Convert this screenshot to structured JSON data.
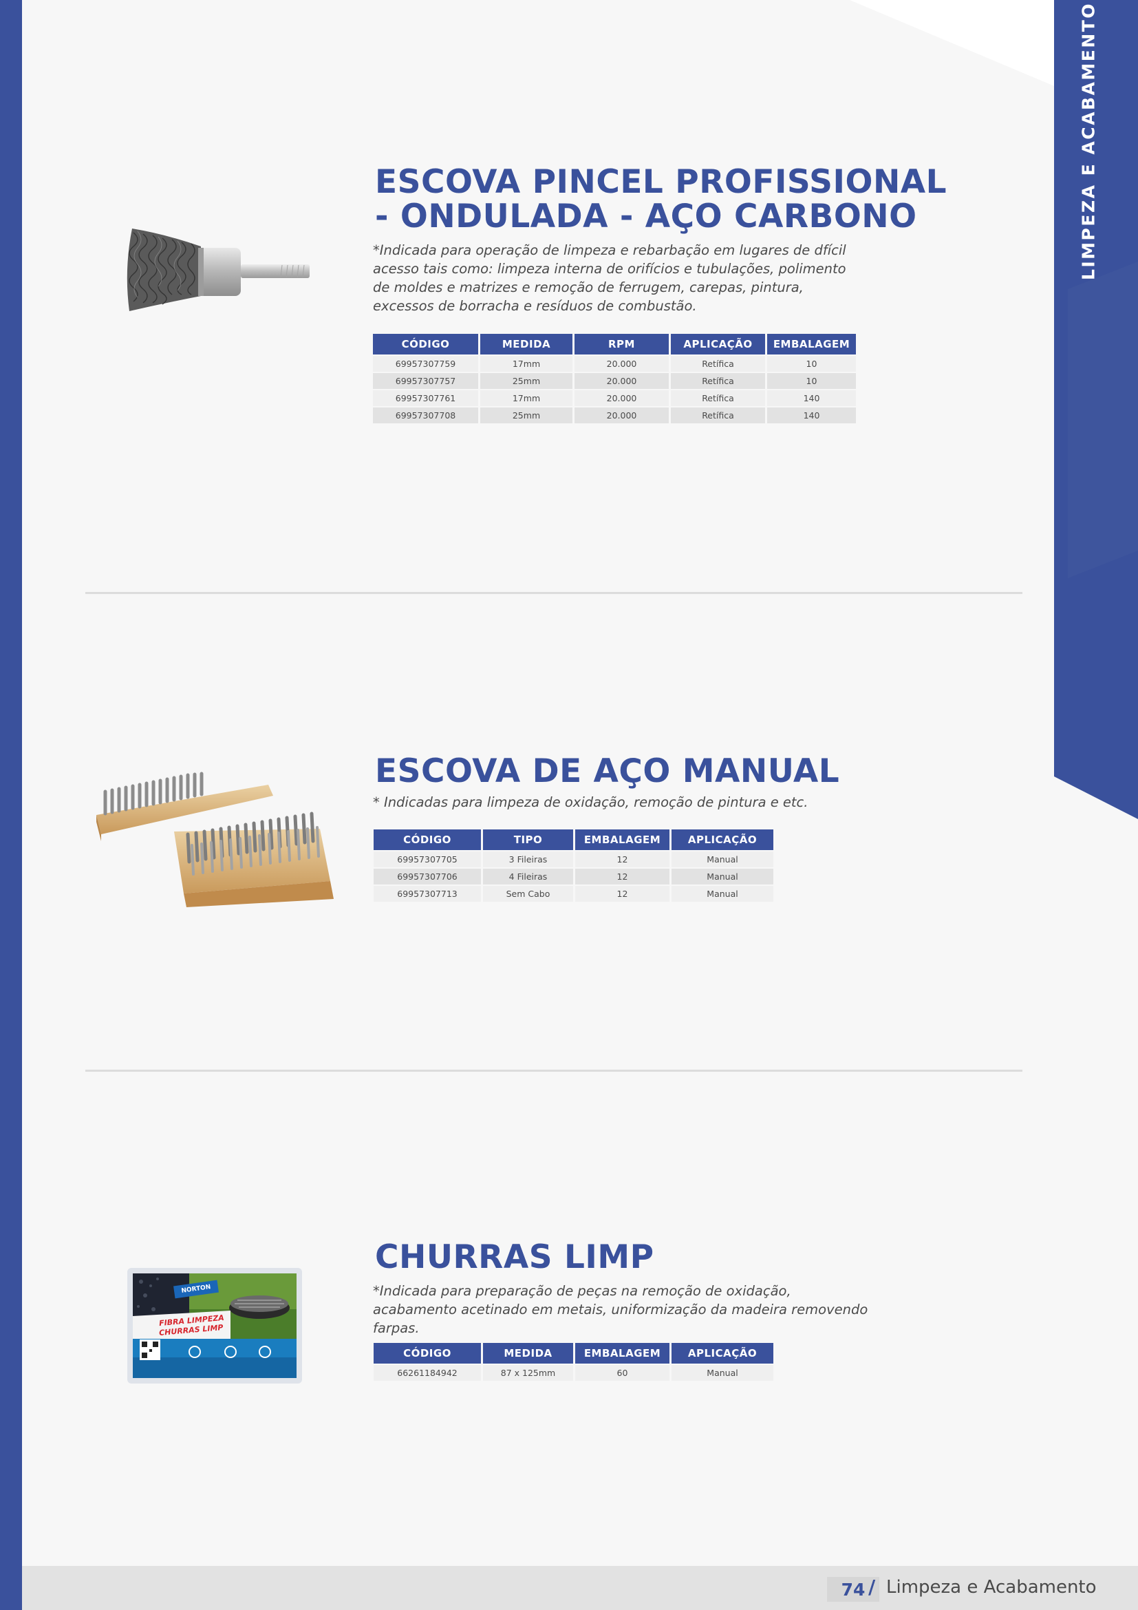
{
  "sidebar": {
    "label": "LIMPEZA E ACABAMENTO"
  },
  "colors": {
    "brand": "#3a519c",
    "background": "#f7f7f7",
    "row_light": "#efefef",
    "row_dark": "#e2e2e2"
  },
  "products": [
    {
      "title_line1": "ESCOVA PINCEL PROFISSIONAL",
      "title_line2": "- ONDULADA - AÇO CARBONO",
      "description": "*Indicada para operação de limpeza e rebarbação em lugares de dfícil acesso tais como: limpeza interna de orifícios e tubulações, polimento de moldes e matrizes e remoção de ferrugem, carepas, pintura, excessos de borracha e resíduos de combustão.",
      "image_icon": "wire-end-brush-icon",
      "columns": [
        "CÓDIGO",
        "MEDIDA",
        "RPM",
        "APLICAÇÃO",
        "EMBALAGEM"
      ],
      "rows": [
        [
          "69957307759",
          "17mm",
          "20.000",
          "Retífica",
          "10"
        ],
        [
          "69957307757",
          "25mm",
          "20.000",
          "Retífica",
          "10"
        ],
        [
          "69957307761",
          "17mm",
          "20.000",
          "Retífica",
          "140"
        ],
        [
          "69957307708",
          "25mm",
          "20.000",
          "Retífica",
          "140"
        ]
      ]
    },
    {
      "title_line1": "ESCOVA DE AÇO MANUAL",
      "description": "* Indicadas para limpeza de oxidação, remoção de pintura e etc.",
      "image_icon": "hand-wire-brush-icon",
      "columns": [
        "CÓDIGO",
        "TIPO",
        "EMBALAGEM",
        "APLICAÇÃO"
      ],
      "rows": [
        [
          "69957307705",
          "3 Fileiras",
          "12",
          "Manual"
        ],
        [
          "69957307706",
          "4 Fileiras",
          "12",
          "Manual"
        ],
        [
          "69957307713",
          "Sem Cabo",
          "12",
          "Manual"
        ]
      ]
    },
    {
      "title_line1": "CHURRAS LIMP",
      "description": "*Indicada para preparação de peças na remoção de oxidação, acabamento acetinado em metais, uniformização da madeira removendo farpas.",
      "image_icon": "cleaning-pad-package-icon",
      "package": {
        "brand": "NORTON",
        "line1": "FIBRA LIMPEZA",
        "line2": "CHURRAS LIMP"
      },
      "columns": [
        "CÓDIGO",
        "MEDIDA",
        "EMBALAGEM",
        "APLICAÇÃO"
      ],
      "rows": [
        [
          "66261184942",
          "87 x 125mm",
          "60",
          "Manual"
        ]
      ]
    }
  ],
  "footer": {
    "page_number": "74",
    "separator": "/",
    "section": "Limpeza e Acabamento"
  }
}
